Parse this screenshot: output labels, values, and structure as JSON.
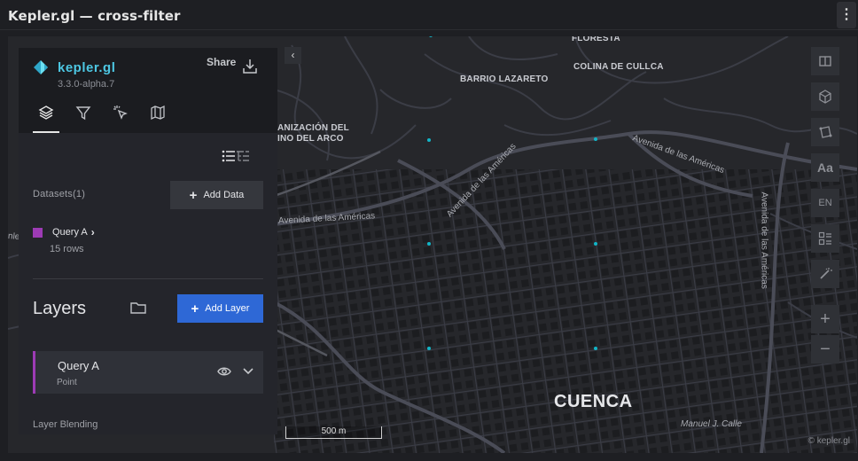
{
  "window": {
    "title": "Kepler.gl — cross-filter",
    "menu_glyph": "⋮"
  },
  "sidebar": {
    "app_name": "kepler.gl",
    "version": "3.3.0-alpha.7",
    "share_label": "Share",
    "tabs": [
      {
        "icon": "layers-icon",
        "active": true
      },
      {
        "icon": "filter-icon",
        "active": false
      },
      {
        "icon": "interaction-icon",
        "active": false
      },
      {
        "icon": "basemap-icon",
        "active": false
      }
    ],
    "datasets_label": "Datasets(1)",
    "add_data_label": "Add Data",
    "dataset": {
      "name": "Query A",
      "rows": "15 rows",
      "color": "#9d3bb5"
    },
    "layers_title": "Layers",
    "add_layer_label": "Add Layer",
    "layer": {
      "name": "Query A",
      "type": "Point",
      "color": "#9d3bb5"
    },
    "layer_blending_label": "Layer Blending"
  },
  "map": {
    "place_labels": {
      "florest": "FLORESTA",
      "colina": "COLINA DE CULLCA",
      "barrio": "BARRIO LAZARETO",
      "org1": "ANIZACIÓN DEL",
      "org2": "INO DEL ARCO",
      "city": "CUENCA"
    },
    "street_labels": {
      "a1": "Avenida de las Américas",
      "a2": "Avenida de las Américas",
      "a3": "Avenida de las Américas",
      "a4": "Avenida de las Américas",
      "side": "nle",
      "calle": "Manuel J. Calle"
    },
    "scale_label": "500 m",
    "attribution": "© kepler.gl",
    "locale_button": "EN",
    "text_button": "Aa",
    "zoom_in": "+",
    "zoom_out": "−",
    "collapse_glyph": "‹",
    "point_color": "#12b5c7"
  }
}
